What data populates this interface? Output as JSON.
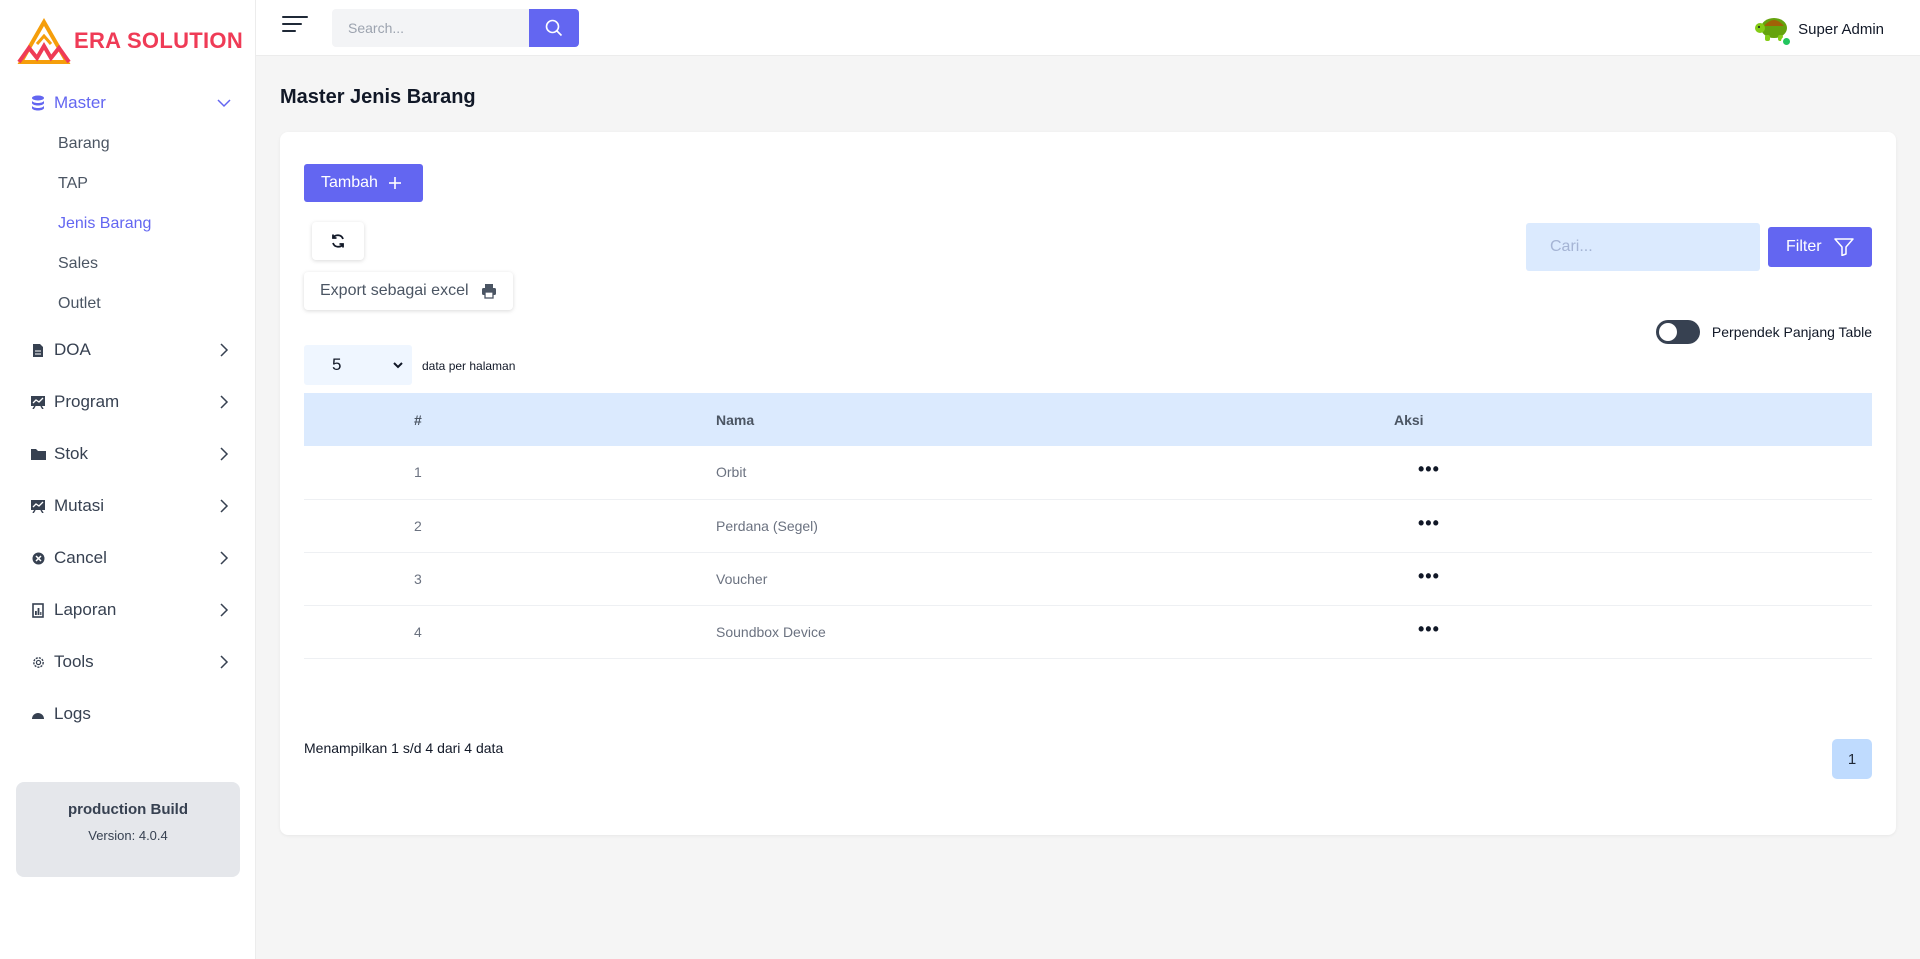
{
  "brand": {
    "name": "ERA SOLUTION",
    "color": "#ef3b56"
  },
  "colors": {
    "accent": "#6366f1",
    "table_header": "#dbeafe",
    "online": "#22c55e"
  },
  "sidebar": {
    "items": [
      {
        "label": "Master",
        "icon": "database-icon",
        "expanded": true,
        "children": [
          "Barang",
          "TAP",
          "Jenis Barang",
          "Sales",
          "Outlet"
        ],
        "active_child": "Jenis Barang"
      },
      {
        "label": "DOA",
        "icon": "document-icon"
      },
      {
        "label": "Program",
        "icon": "chart-board-icon"
      },
      {
        "label": "Stok",
        "icon": "folder-icon"
      },
      {
        "label": "Mutasi",
        "icon": "chart-board-icon"
      },
      {
        "label": "Cancel",
        "icon": "cancel-circle-icon"
      },
      {
        "label": "Laporan",
        "icon": "report-icon"
      },
      {
        "label": "Tools",
        "icon": "gear-icon"
      },
      {
        "label": "Logs",
        "icon": "logs-icon"
      }
    ],
    "build": {
      "title": "production Build",
      "version": "Version: 4.0.4"
    }
  },
  "topbar": {
    "search_placeholder": "Search...",
    "user_name": "Super Admin"
  },
  "page": {
    "title": "Master Jenis Barang",
    "add_button": "Tambah",
    "export_button": "Export sebagai excel",
    "search_placeholder": "Cari...",
    "filter_button": "Filter",
    "toggle_label": "Perpendek Panjang Table",
    "toggle_on": false,
    "per_page_value": "5",
    "per_page_label": "data per halaman",
    "table": {
      "headers": [
        "#",
        "Nama",
        "Aksi"
      ],
      "rows": [
        {
          "no": "1",
          "nama": "Orbit"
        },
        {
          "no": "2",
          "nama": "Perdana (Segel)"
        },
        {
          "no": "3",
          "nama": "Voucher"
        },
        {
          "no": "4",
          "nama": "Soundbox Device"
        }
      ]
    },
    "showing_text": "Menampilkan 1 s/d 4 dari 4 data",
    "current_page": "1"
  }
}
